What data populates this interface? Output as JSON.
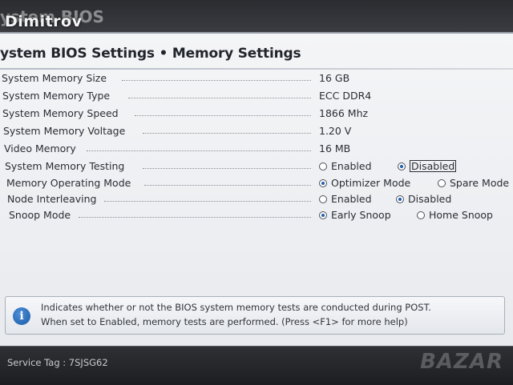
{
  "overlay_text": "Dimitrov",
  "header_text": "ystem BIOS",
  "page_title": "ystem BIOS Settings • Memory Settings",
  "settings": [
    {
      "label": "System Memory Size",
      "value": "16 GB"
    },
    {
      "label": "System Memory Type",
      "value": "ECC DDR4"
    },
    {
      "label": "System Memory Speed",
      "value": "1866 Mhz"
    },
    {
      "label": "System Memory Voltage",
      "value": "1.20 V"
    },
    {
      "label": "Video Memory",
      "value": "16 MB"
    },
    {
      "label": "System Memory Testing",
      "options": [
        {
          "text": "Enabled",
          "selected": false
        },
        {
          "text": "Disabled",
          "selected": true
        }
      ]
    },
    {
      "label": "Memory Operating Mode",
      "options": [
        {
          "text": "Optimizer Mode",
          "selected": true
        },
        {
          "text": "Spare Mode",
          "selected": false
        }
      ]
    },
    {
      "label": "Node Interleaving",
      "options": [
        {
          "text": "Enabled",
          "selected": false
        },
        {
          "text": "Disabled",
          "selected": true
        }
      ]
    },
    {
      "label": "Snoop Mode",
      "options": [
        {
          "text": "Early Snoop",
          "selected": true
        },
        {
          "text": "Home Snoop",
          "selected": false
        }
      ]
    }
  ],
  "help": {
    "icon": "info-icon",
    "line1": "Indicates whether or not the BIOS system memory tests are conducted during POST.",
    "line2": "When set to Enabled, memory tests are performed. (Press <F1> for more help)"
  },
  "footer": {
    "service_tag": "Service Tag : 7SJSG62"
  },
  "watermark": "BAZAR"
}
